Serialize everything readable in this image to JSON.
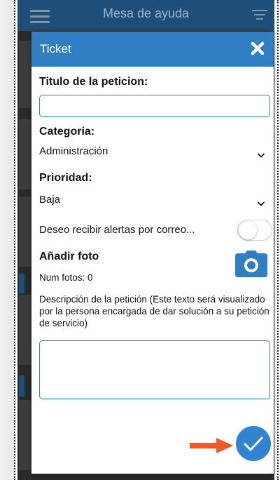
{
  "app": {
    "title": "Mesa de ayuda"
  },
  "modal": {
    "title": "Ticket",
    "titulo_label": "Titulo de la peticion:",
    "titulo_value": "",
    "categoria_label": "Categoria:",
    "categoria_value": "Administración",
    "prioridad_label": "Prioridad:",
    "prioridad_value": "Baja",
    "alertas_label": "Deseo recibir alertas por correo...",
    "alertas_enabled": false,
    "foto_label": "Añadir foto",
    "num_fotos": "Num fotos: 0",
    "descripcion_label": "Descripción de la petición (Este texto será visualizado por la persona encargada de dar solución a su petición de servicio)",
    "descripcion_value": ""
  },
  "colors": {
    "header": "#1e4e7a",
    "modal_header": "#2f7fc2",
    "accent": "#3384d0",
    "arrow": "#f0582a"
  }
}
